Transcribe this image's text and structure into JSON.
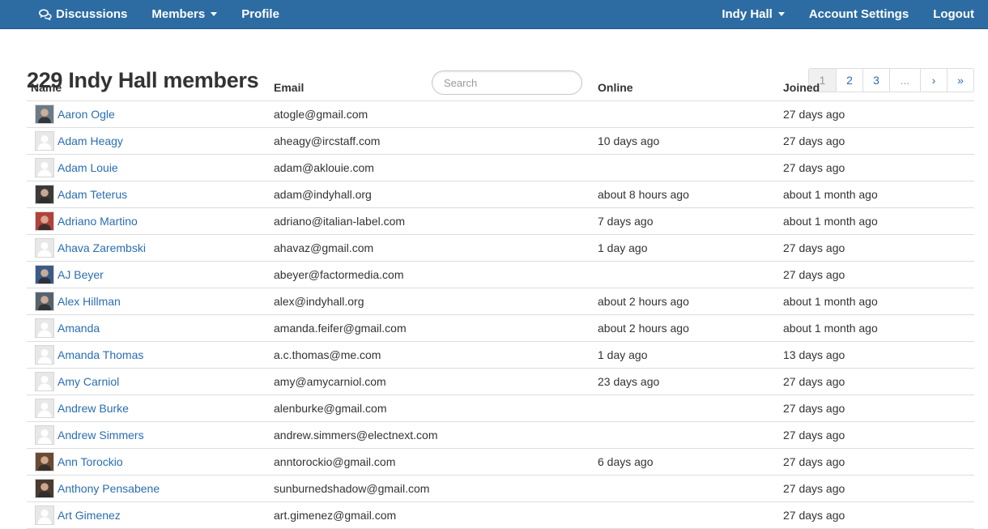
{
  "nav": {
    "left": [
      {
        "label": "Discussions",
        "icon": "chat-bubbles-icon",
        "dropdown": false
      },
      {
        "label": "Members",
        "dropdown": true
      },
      {
        "label": "Profile",
        "dropdown": false
      }
    ],
    "right": [
      {
        "label": "Indy Hall",
        "dropdown": true
      },
      {
        "label": "Account Settings",
        "dropdown": false
      },
      {
        "label": "Logout",
        "dropdown": false
      }
    ]
  },
  "page_title": "229 Indy Hall members",
  "search": {
    "placeholder": "Search",
    "value": ""
  },
  "pagination": [
    "1",
    "2",
    "3",
    "...",
    "›",
    "»"
  ],
  "pagination_active": "1",
  "table": {
    "headers": [
      "Name",
      "Email",
      "Online",
      "Joined"
    ],
    "rows": [
      {
        "name": "Aaron Ogle",
        "email": "atogle@gmail.com",
        "online": "",
        "joined": "27 days ago",
        "avatar": "photo",
        "tone": "#6b7a88"
      },
      {
        "name": "Adam Heagy",
        "email": "aheagy@ircstaff.com",
        "online": "10 days ago",
        "joined": "27 days ago",
        "avatar": "default",
        "tone": ""
      },
      {
        "name": "Adam Louie",
        "email": "adam@aklouie.com",
        "online": "",
        "joined": "27 days ago",
        "avatar": "default",
        "tone": ""
      },
      {
        "name": "Adam Teterus",
        "email": "adam@indyhall.org",
        "online": "about 8 hours ago",
        "joined": "about 1 month ago",
        "avatar": "photo",
        "tone": "#3a3a3a"
      },
      {
        "name": "Adriano Martino",
        "email": "adriano@italian-label.com",
        "online": "7 days ago",
        "joined": "about 1 month ago",
        "avatar": "photo",
        "tone": "#b2413b"
      },
      {
        "name": "Ahava Zarembski",
        "email": "ahavaz@gmail.com",
        "online": "1 day ago",
        "joined": "27 days ago",
        "avatar": "default",
        "tone": ""
      },
      {
        "name": "AJ Beyer",
        "email": "abeyer@factormedia.com",
        "online": "",
        "joined": "27 days ago",
        "avatar": "photo",
        "tone": "#3b5a86"
      },
      {
        "name": "Alex Hillman",
        "email": "alex@indyhall.org",
        "online": "about 2 hours ago",
        "joined": "about 1 month ago",
        "avatar": "photo",
        "tone": "#55636e"
      },
      {
        "name": "Amanda",
        "email": "amanda.feifer@gmail.com",
        "online": "about 2 hours ago",
        "joined": "about 1 month ago",
        "avatar": "default",
        "tone": ""
      },
      {
        "name": "Amanda Thomas",
        "email": "a.c.thomas@me.com",
        "online": "1 day ago",
        "joined": "13 days ago",
        "avatar": "default",
        "tone": ""
      },
      {
        "name": "Amy Carniol",
        "email": "amy@amycarniol.com",
        "online": "23 days ago",
        "joined": "27 days ago",
        "avatar": "default",
        "tone": ""
      },
      {
        "name": "Andrew Burke",
        "email": "alenburke@gmail.com",
        "online": "",
        "joined": "27 days ago",
        "avatar": "default",
        "tone": ""
      },
      {
        "name": "Andrew Simmers",
        "email": "andrew.simmers@electnext.com",
        "online": "",
        "joined": "27 days ago",
        "avatar": "default",
        "tone": ""
      },
      {
        "name": "Ann Torockio",
        "email": "anntorockio@gmail.com",
        "online": "6 days ago",
        "joined": "27 days ago",
        "avatar": "photo",
        "tone": "#6a4a32"
      },
      {
        "name": "Anthony Pensabene",
        "email": "sunburnedshadow@gmail.com",
        "online": "",
        "joined": "27 days ago",
        "avatar": "photo",
        "tone": "#4a3a30"
      },
      {
        "name": "Art Gimenez",
        "email": "art.gimenez@gmail.com",
        "online": "",
        "joined": "27 days ago",
        "avatar": "default",
        "tone": ""
      }
    ]
  }
}
